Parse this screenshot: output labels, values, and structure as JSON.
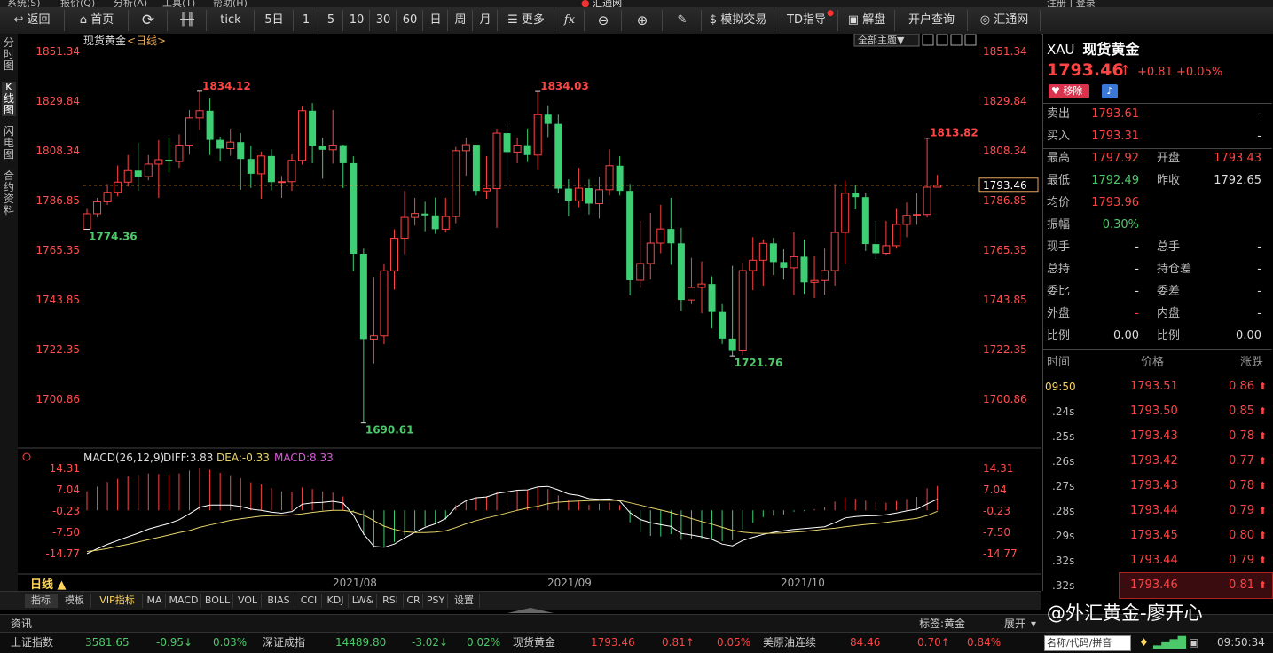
{
  "menu": {
    "items": [
      "系统(S)",
      "报价(Q)",
      "分析(A)",
      "工具(T)",
      "帮助(H)"
    ],
    "title": "汇通网",
    "login": "注册 | 登录"
  },
  "toolbar": {
    "back": "返回",
    "home": "首页",
    "tick": "tick",
    "periods": [
      "5日",
      "1",
      "5",
      "10",
      "30",
      "60",
      "日",
      "周",
      "月"
    ],
    "more": "更多",
    "fx": "fx",
    "sim_trade": "模拟交易",
    "td_guide": "TD指导",
    "analysis": "解盘",
    "account": "开户查询",
    "site": "汇通网"
  },
  "left_tabs": [
    {
      "label": "分时图",
      "selected": false
    },
    {
      "label": "K线图",
      "selected": true
    },
    {
      "label": "闪电图",
      "selected": false
    },
    {
      "label": "合约资料",
      "selected": false
    }
  ],
  "chart": {
    "instrument_label": "现货黄金",
    "period_label": "<日线>",
    "theme_button": "全部主题▼",
    "current_price_tag": "1793.46",
    "period_selector": "日线 ▲",
    "y_ticks": [
      "1851.34",
      "1829.84",
      "1808.34",
      "1786.85",
      "1765.35",
      "1743.85",
      "1722.35",
      "1700.86"
    ],
    "x_labels": [
      "2021/08",
      "2021/09",
      "2021/10"
    ],
    "annotations": [
      {
        "text": "1834.12",
        "color": "#ff4444"
      },
      {
        "text": "1774.36",
        "color": "#4cc96a"
      },
      {
        "text": "1834.03",
        "color": "#ff4444"
      },
      {
        "text": "1690.61",
        "color": "#4cc96a"
      },
      {
        "text": "1721.76",
        "color": "#4cc96a"
      },
      {
        "text": "1813.82",
        "color": "#ff4444"
      }
    ],
    "macd": {
      "title": "MACD(26,12,9)",
      "diff": "DIFF:3.83",
      "dea": "DEA:-0.33",
      "macd": "MACD:8.33",
      "y_ticks": [
        "14.31",
        "7.04",
        "-0.23",
        "-7.50",
        "-14.77"
      ]
    }
  },
  "chart_data": {
    "type": "candlestick",
    "ylim": [
      1690.61,
      1851.34
    ],
    "candles": [
      [
        1774.36,
        1781.1,
        1783.2,
        1774.36
      ],
      [
        1781.1,
        1786.3,
        1788.0,
        1779.5
      ],
      [
        1786.3,
        1790.4,
        1794.0,
        1784.9
      ],
      [
        1790.4,
        1794.8,
        1802.0,
        1788.6
      ],
      [
        1794.8,
        1799.8,
        1806.5,
        1792.9
      ],
      [
        1799.8,
        1797.2,
        1812.0,
        1791.0
      ],
      [
        1797.2,
        1802.6,
        1806.5,
        1795.6
      ],
      [
        1802.6,
        1804.5,
        1813.0,
        1788.0
      ],
      [
        1804.5,
        1803.7,
        1814.0,
        1799.0
      ],
      [
        1803.7,
        1810.8,
        1815.5,
        1801.0
      ],
      [
        1810.8,
        1822.6,
        1826.0,
        1806.7
      ],
      [
        1822.6,
        1825.7,
        1834.12,
        1817.4
      ],
      [
        1825.7,
        1813.1,
        1831.0,
        1806.5
      ],
      [
        1813.1,
        1809.3,
        1814.5,
        1803.8
      ],
      [
        1809.3,
        1812.1,
        1818.0,
        1806.2
      ],
      [
        1812.1,
        1804.8,
        1816.0,
        1791.5
      ],
      [
        1804.8,
        1798.4,
        1810.5,
        1792.3
      ],
      [
        1798.4,
        1806.1,
        1808.0,
        1787.6
      ],
      [
        1806.1,
        1794.8,
        1809.0,
        1791.2
      ],
      [
        1794.8,
        1795.0,
        1797.5,
        1788.0
      ],
      [
        1795.0,
        1804.2,
        1806.8,
        1791.0
      ],
      [
        1804.2,
        1825.7,
        1827.5,
        1802.4
      ],
      [
        1825.7,
        1810.6,
        1829.0,
        1803.0
      ],
      [
        1810.6,
        1808.8,
        1814.0,
        1796.3
      ],
      [
        1808.8,
        1810.8,
        1826.0,
        1802.8
      ],
      [
        1810.8,
        1803.0,
        1811.0,
        1792.2
      ],
      [
        1803.0,
        1763.8,
        1806.0,
        1756.2
      ],
      [
        1763.8,
        1726.8,
        1766.0,
        1690.61
      ],
      [
        1726.8,
        1728.2,
        1753.7,
        1716.3
      ],
      [
        1728.2,
        1756.4,
        1759.4,
        1724.6
      ],
      [
        1756.4,
        1770.5,
        1774.3,
        1748.2
      ],
      [
        1770.5,
        1779.5,
        1791.0,
        1763.6
      ],
      [
        1779.5,
        1781.2,
        1788.0,
        1776.0
      ],
      [
        1781.2,
        1780.4,
        1786.3,
        1773.5
      ],
      [
        1780.4,
        1774.4,
        1788.1,
        1772.4
      ],
      [
        1774.4,
        1779.9,
        1788.0,
        1773.0
      ],
      [
        1779.9,
        1808.4,
        1810.0,
        1777.0
      ],
      [
        1808.4,
        1811.0,
        1814.0,
        1797.6
      ],
      [
        1811.0,
        1791.0,
        1808.0,
        1789.0
      ],
      [
        1791.0,
        1792.0,
        1806.0,
        1787.6
      ],
      [
        1792.0,
        1816.0,
        1818.0,
        1775.0
      ],
      [
        1816.0,
        1807.8,
        1821.0,
        1795.7
      ],
      [
        1807.8,
        1810.8,
        1814.0,
        1803.0
      ],
      [
        1810.8,
        1806.5,
        1818.0,
        1803.5
      ],
      [
        1806.5,
        1824.0,
        1834.03,
        1800.0
      ],
      [
        1824.0,
        1820.0,
        1828.0,
        1814.3
      ],
      [
        1820.0,
        1792.0,
        1824.0,
        1790.0
      ],
      [
        1792.0,
        1786.7,
        1796.0,
        1780.0
      ],
      [
        1786.7,
        1792.2,
        1801.0,
        1784.0
      ],
      [
        1792.2,
        1785.5,
        1796.0,
        1780.8
      ],
      [
        1785.5,
        1791.5,
        1797.0,
        1779.0
      ],
      [
        1791.5,
        1801.9,
        1809.0,
        1789.0
      ],
      [
        1801.9,
        1791.0,
        1806.0,
        1789.0
      ],
      [
        1791.0,
        1752.3,
        1794.0,
        1745.8
      ],
      [
        1752.3,
        1759.6,
        1778.0,
        1749.0
      ],
      [
        1759.6,
        1768.4,
        1781.5,
        1752.6
      ],
      [
        1768.4,
        1774.5,
        1785.0,
        1764.0
      ],
      [
        1774.5,
        1768.3,
        1788.0,
        1759.0
      ],
      [
        1768.3,
        1743.8,
        1775.0,
        1739.0
      ],
      [
        1743.8,
        1749.2,
        1762.0,
        1742.0
      ],
      [
        1749.2,
        1750.7,
        1760.5,
        1738.0
      ],
      [
        1750.7,
        1738.6,
        1754.0,
        1731.5
      ],
      [
        1738.6,
        1727.0,
        1742.0,
        1724.7
      ],
      [
        1727.0,
        1721.76,
        1758.6,
        1719.6
      ],
      [
        1721.76,
        1756.5,
        1760.0,
        1720.0
      ],
      [
        1756.5,
        1761.0,
        1771.0,
        1748.0
      ],
      [
        1761.0,
        1768.3,
        1770.0,
        1750.0
      ],
      [
        1768.3,
        1760.2,
        1770.7,
        1754.6
      ],
      [
        1760.2,
        1757.7,
        1765.7,
        1752.6
      ],
      [
        1757.7,
        1762.5,
        1773.0,
        1746.0
      ],
      [
        1762.5,
        1751.4,
        1770.0,
        1746.5
      ],
      [
        1751.4,
        1752.2,
        1763.0,
        1744.6
      ],
      [
        1752.2,
        1756.5,
        1766.0,
        1746.0
      ],
      [
        1756.5,
        1773.0,
        1794.0,
        1750.0
      ],
      [
        1773.0,
        1790.0,
        1795.5,
        1759.5
      ],
      [
        1790.0,
        1788.3,
        1793.5,
        1783.0
      ],
      [
        1788.3,
        1768.0,
        1790.0,
        1765.0
      ],
      [
        1768.0,
        1764.0,
        1778.0,
        1761.5
      ],
      [
        1764.0,
        1767.3,
        1778.0,
        1763.4
      ],
      [
        1767.3,
        1776.5,
        1783.2,
        1766.0
      ],
      [
        1776.5,
        1780.4,
        1786.0,
        1771.0
      ],
      [
        1780.4,
        1780.8,
        1790.0,
        1776.3
      ],
      [
        1780.8,
        1792.6,
        1813.82,
        1779.5
      ],
      [
        1792.6,
        1793.46,
        1797.92,
        1792.49
      ]
    ],
    "macd_hist": [
      6.5,
      8.1,
      9.7,
      10.8,
      11.6,
      12.0,
      12.6,
      12.4,
      12.1,
      12.6,
      13.6,
      14.31,
      13.9,
      12.8,
      12.0,
      11.0,
      9.6,
      8.9,
      7.6,
      6.5,
      6.4,
      7.8,
      7.3,
      6.5,
      6.1,
      4.8,
      -0.6,
      -8.4,
      -12.7,
      -12.4,
      -10.8,
      -8.5,
      -6.8,
      -5.5,
      -4.6,
      -3.2,
      1.8,
      3.6,
      4.4,
      4.8,
      6.2,
      6.6,
      7.0,
      6.8,
      7.8,
      7.3,
      5.1,
      3.6,
      3.0,
      1.9,
      2.3,
      2.6,
      1.8,
      -4.1,
      -7.5,
      -8.7,
      -8.9,
      -8.1,
      -10.1,
      -9.9,
      -9.6,
      -9.8,
      -10.5,
      -10.2,
      -6.5,
      -4.2,
      -2.3,
      -1.8,
      -1.4,
      -0.5,
      -0.3,
      0.4,
      1.1,
      3.0,
      4.4,
      4.0,
      3.3,
      2.7,
      2.6,
      3.2,
      3.9,
      4.6,
      7.5,
      8.33
    ],
    "diff_line": [
      -14.77,
      -13.1,
      -11.6,
      -10.3,
      -9.0,
      -7.8,
      -6.4,
      -5.4,
      -4.5,
      -3.2,
      -1.2,
      1.0,
      1.8,
      1.8,
      1.8,
      1.3,
      0.4,
      0.0,
      -0.6,
      -1.0,
      -0.4,
      2.1,
      2.6,
      2.7,
      3.1,
      2.5,
      -1.6,
      -8.0,
      -12.3,
      -12.6,
      -11.5,
      -9.4,
      -7.5,
      -5.8,
      -4.6,
      -2.8,
      1.1,
      3.3,
      4.3,
      4.6,
      5.8,
      6.3,
      6.9,
      7.0,
      8.0,
      8.2,
      7.0,
      5.6,
      5.1,
      4.0,
      3.8,
      3.9,
      3.2,
      -0.8,
      -3.1,
      -4.2,
      -4.9,
      -5.5,
      -7.9,
      -8.4,
      -9.0,
      -9.9,
      -11.5,
      -12.1,
      -10.3,
      -9.2,
      -8.2,
      -7.5,
      -7.0,
      -6.5,
      -6.2,
      -5.9,
      -5.6,
      -4.2,
      -2.6,
      -2.1,
      -1.9,
      -1.8,
      -1.5,
      -0.9,
      -0.2,
      0.4,
      2.2,
      3.83
    ],
    "dea_line": [
      -14.0,
      -13.6,
      -13.0,
      -12.3,
      -11.6,
      -10.8,
      -10.0,
      -9.2,
      -8.4,
      -7.6,
      -6.9,
      -5.8,
      -5.0,
      -4.2,
      -3.4,
      -2.9,
      -2.4,
      -2.0,
      -1.8,
      -1.7,
      -1.6,
      -1.2,
      -0.7,
      -0.3,
      0.0,
      0.0,
      -0.5,
      -1.6,
      -3.5,
      -5.4,
      -6.5,
      -7.3,
      -7.6,
      -7.6,
      -7.4,
      -7.0,
      -5.9,
      -4.6,
      -3.5,
      -2.6,
      -1.8,
      -0.9,
      0.0,
      0.8,
      1.4,
      2.3,
      2.8,
      3.0,
      3.2,
      3.3,
      3.4,
      3.4,
      3.4,
      2.6,
      1.8,
      0.9,
      0.1,
      -0.7,
      -1.8,
      -2.8,
      -3.8,
      -4.7,
      -5.8,
      -6.8,
      -7.4,
      -7.7,
      -7.9,
      -7.8,
      -7.7,
      -7.4,
      -7.2,
      -6.8,
      -6.4,
      -6.1,
      -5.6,
      -5.2,
      -4.8,
      -4.5,
      -4.1,
      -3.6,
      -3.2,
      -2.7,
      -1.8,
      -0.33
    ]
  },
  "quote": {
    "symbol": "XAU",
    "name": "现货黄金",
    "price": "1793.46",
    "arrow": "↑",
    "change": "+0.81",
    "change_pct": "+0.05%",
    "remove_button": "移除",
    "rows": [
      [
        {
          "l": "卖出"
        },
        {
          "v": "1793.61",
          "c": "red"
        },
        {
          "l": ""
        },
        {
          "v": "-",
          "c": "white"
        }
      ],
      [
        {
          "l": "买入"
        },
        {
          "v": "1793.31",
          "c": "red"
        },
        {
          "l": ""
        },
        {
          "v": "-",
          "c": "white"
        }
      ]
    ],
    "stats": [
      [
        {
          "l": "最高"
        },
        {
          "v": "1797.92",
          "c": "red"
        },
        {
          "l": "开盘"
        },
        {
          "v": "1793.43",
          "c": "red"
        }
      ],
      [
        {
          "l": "最低"
        },
        {
          "v": "1792.49",
          "c": "green"
        },
        {
          "l": "昨收"
        },
        {
          "v": "1792.65",
          "c": "white"
        }
      ],
      [
        {
          "l": "均价"
        },
        {
          "v": "1793.96",
          "c": "red"
        },
        {
          "l": ""
        },
        {
          "v": "",
          "c": "white"
        }
      ],
      [
        {
          "l": "振幅"
        },
        {
          "v": "0.30%",
          "c": "green"
        },
        {
          "l": ""
        },
        {
          "v": "",
          "c": "white"
        }
      ],
      [
        {
          "l": "现手"
        },
        {
          "v": "-",
          "c": "white"
        },
        {
          "l": "总手"
        },
        {
          "v": "-",
          "c": "white"
        }
      ],
      [
        {
          "l": "总持"
        },
        {
          "v": "-",
          "c": "white"
        },
        {
          "l": "持仓差"
        },
        {
          "v": "-",
          "c": "white"
        }
      ],
      [
        {
          "l": "委比"
        },
        {
          "v": "-",
          "c": "white"
        },
        {
          "l": "委差"
        },
        {
          "v": "-",
          "c": "white"
        }
      ],
      [
        {
          "l": "外盘"
        },
        {
          "v": "-",
          "c": "red"
        },
        {
          "l": "内盘"
        },
        {
          "v": "-",
          "c": "white"
        }
      ],
      [
        {
          "l": "比例"
        },
        {
          "v": "0.00",
          "c": "white"
        },
        {
          "l": "比例"
        },
        {
          "v": "0.00",
          "c": "white"
        }
      ]
    ],
    "ticks_header": {
      "time": "时间",
      "price": "价格",
      "change": "涨跌"
    },
    "ticks": [
      {
        "t": "09:50",
        "p": "1793.51",
        "c": "0.86"
      },
      {
        "t": ".24s",
        "p": "1793.50",
        "c": "0.85"
      },
      {
        "t": ".25s",
        "p": "1793.43",
        "c": "0.78"
      },
      {
        "t": ".26s",
        "p": "1793.42",
        "c": "0.77"
      },
      {
        "t": ".27s",
        "p": "1793.43",
        "c": "0.78"
      },
      {
        "t": ".28s",
        "p": "1793.44",
        "c": "0.79"
      },
      {
        "t": ".29s",
        "p": "1793.45",
        "c": "0.80"
      },
      {
        "t": ".32s",
        "p": "1793.44",
        "c": "0.79"
      },
      {
        "t": ".32s",
        "p": "1793.46",
        "c": "0.81"
      }
    ]
  },
  "bottom_tabs": [
    "指标",
    "模板",
    "VIP指标",
    "MA",
    "MACD",
    "BOLL",
    "VOL",
    "BIAS",
    "CCI",
    "KDJ",
    "LW&",
    "RSI",
    "CR",
    "PSY",
    "设置"
  ],
  "infobar": {
    "news": "资讯",
    "tag": "标签:黄金",
    "expand": "展开",
    "watermark": "@外汇黄金-廖开心"
  },
  "status": {
    "items": [
      {
        "n": "上证指数",
        "p": "3581.65",
        "c": "-0.95↓",
        "pct": "0.03%",
        "cc": "green",
        "pc": "green"
      },
      {
        "n": "深证成指",
        "p": "14489.80",
        "c": "-3.02↓",
        "pct": "0.02%",
        "cc": "green",
        "pc": "green"
      },
      {
        "n": "现货黄金",
        "p": "1793.46",
        "c": "0.81↑",
        "pct": "0.05%",
        "cc": "red",
        "pc": "red"
      },
      {
        "n": "美原油连续",
        "p": "84.46",
        "c": "0.70↑",
        "pct": "0.84%",
        "cc": "red",
        "pc": "red"
      }
    ],
    "search_placeholder": "名称/代码/拼音",
    "clock": "09:50:34"
  }
}
